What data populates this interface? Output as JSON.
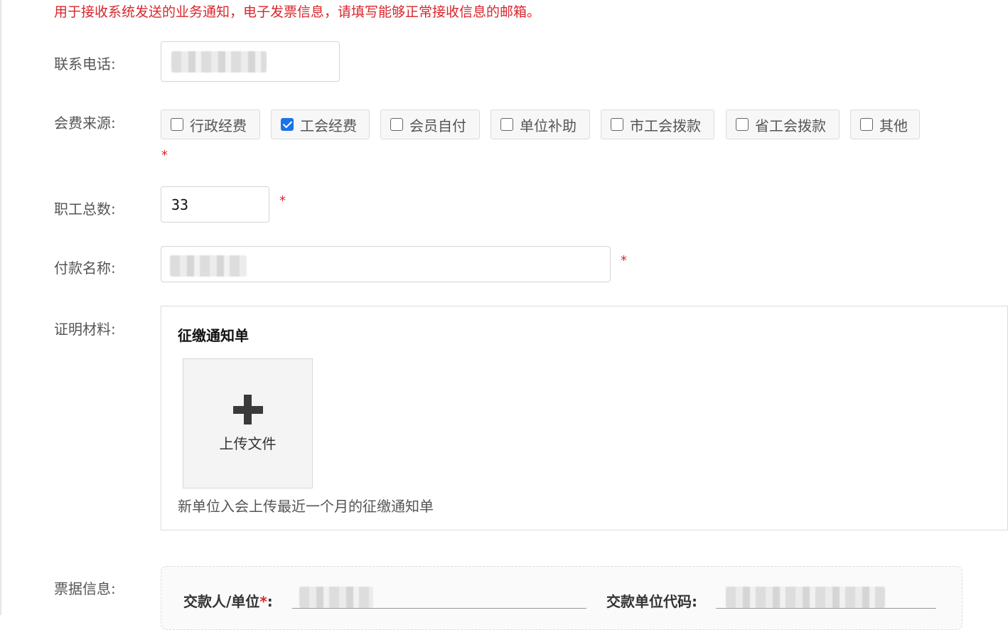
{
  "notice": "用于接收系统发送的业务通知，电子发票信息，请填写能够正常接收信息的邮箱。",
  "phone": {
    "label": "联系电话:",
    "value": ""
  },
  "fee_source": {
    "label": "会费来源:",
    "options": [
      {
        "label": "行政经费",
        "checked": false
      },
      {
        "label": "工会经费",
        "checked": true
      },
      {
        "label": "会员自付",
        "checked": false
      },
      {
        "label": "单位补助",
        "checked": false
      },
      {
        "label": "市工会拨款",
        "checked": false
      },
      {
        "label": "省工会拨款",
        "checked": false
      },
      {
        "label": "其他",
        "checked": false
      }
    ]
  },
  "required_mark": "*",
  "staff_count": {
    "label": "职工总数:",
    "value": "33"
  },
  "payer_name": {
    "label": "付款名称:",
    "value": ""
  },
  "proof": {
    "label": "证明材料:",
    "title": "征缴通知单",
    "upload_label": "上传文件",
    "hint": "新单位入会上传最近一个月的征缴通知单"
  },
  "bill": {
    "label": "票据信息:",
    "payer_label": "交款人/单位",
    "payer_suffix": ":",
    "code_label": "交款单位代码:"
  },
  "colors": {
    "accent": "#1a73e8",
    "required": "#d9262c"
  },
  "icons": {
    "upload": "plus-icon",
    "check": "checkbox-check-icon"
  }
}
